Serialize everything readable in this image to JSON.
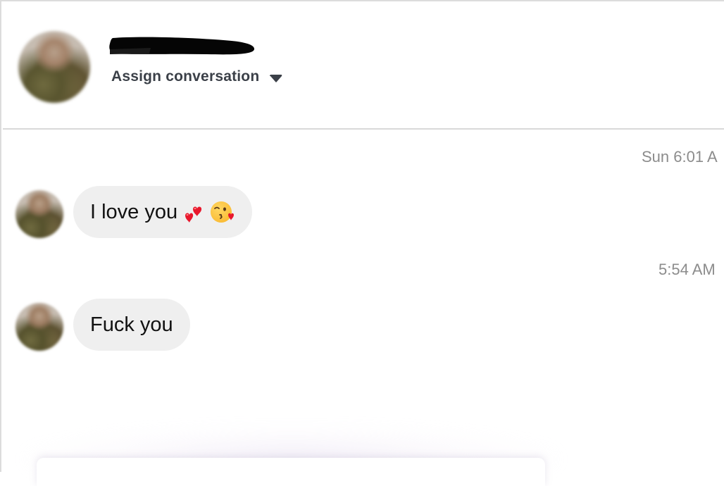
{
  "header": {
    "contact_name_redacted": true,
    "assign_label": "Assign conversation",
    "assign_dropdown_icon": "caret-down-icon"
  },
  "thread": {
    "messages": [
      {
        "timestamp": "Sun 6:01 A",
        "text": "I love you",
        "emojis": [
          "two-hearts-emoji",
          "kissing-face-emoji"
        ]
      },
      {
        "timestamp": "5:54 AM",
        "text": "Fuck you",
        "emojis": []
      }
    ]
  },
  "colors": {
    "bubble_bg": "#efefef",
    "timestamp": "#8c8c8c",
    "assign_text": "#3b4048",
    "divider": "#d9d9d9"
  }
}
